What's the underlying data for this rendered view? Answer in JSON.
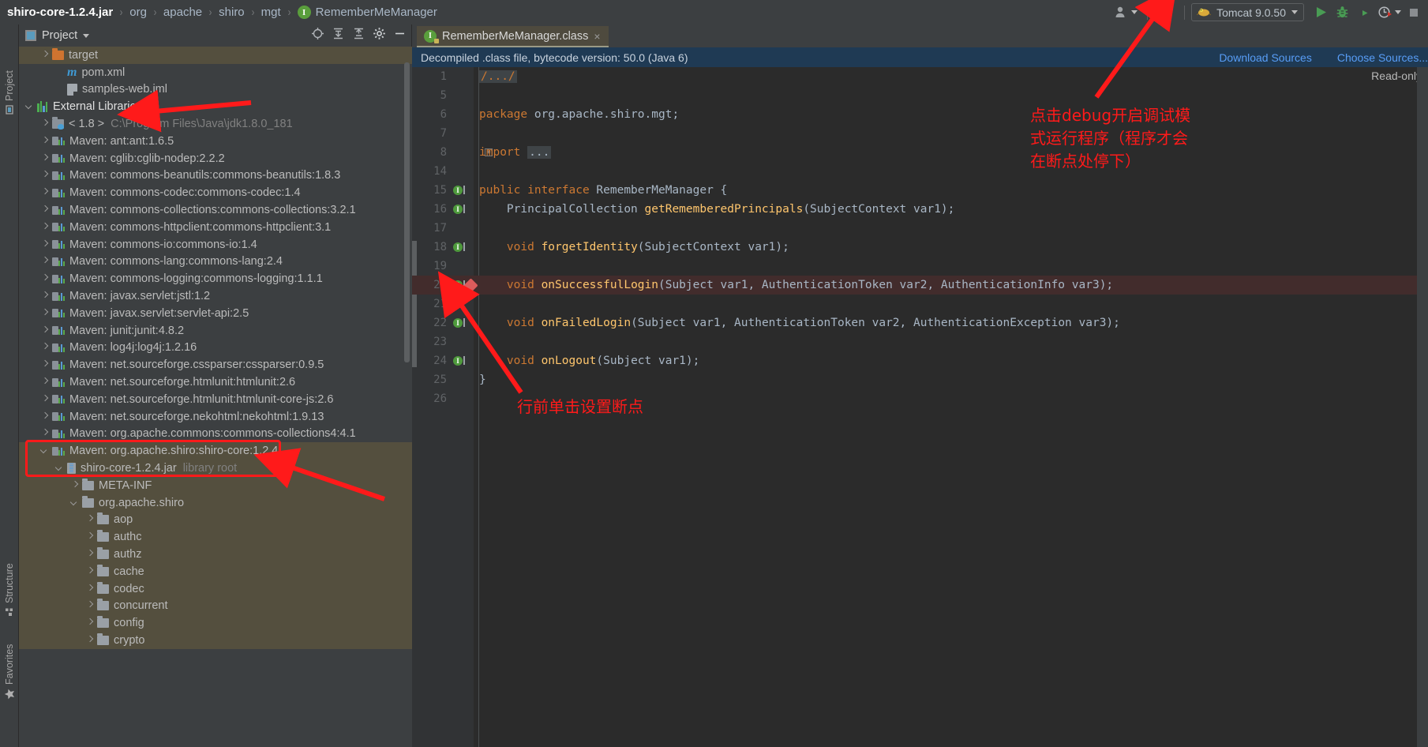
{
  "breadcrumb": {
    "items": [
      {
        "label": "shiro-core-1.2.4.jar",
        "strong": true
      },
      {
        "label": "org",
        "strong": false
      },
      {
        "label": "apache",
        "strong": false
      },
      {
        "label": "shiro",
        "strong": false
      },
      {
        "label": "mgt",
        "strong": false
      },
      {
        "label": "RememberMeManager",
        "strong": false,
        "badge": "I"
      }
    ],
    "separator": "›"
  },
  "toolbar": {
    "user_icon": "user-icon",
    "update_icon": "update-project-icon",
    "run_config": {
      "name": "Tomcat 9.0.50",
      "icon": "tomcat-icon"
    },
    "run_label": "Run",
    "debug_label": "Debug",
    "run_coverage_label": "Run with Coverage",
    "profiler_label": "Profiler",
    "stop_label": "Stop"
  },
  "left_strip": {
    "project_label": "Project",
    "structure_label": "Structure",
    "favorites_label": "Favorites"
  },
  "project_panel": {
    "title": "Project",
    "header_icons": [
      "locate-icon",
      "expand-all-icon",
      "collapse-all-icon",
      "settings-icon",
      "hide-icon"
    ],
    "tree": [
      {
        "indent": 1,
        "arrow": "right",
        "icon": "folder-orange",
        "label": "target",
        "selected": true
      },
      {
        "indent": 2,
        "arrow": "none",
        "icon": "maven-pom",
        "label": "pom.xml"
      },
      {
        "indent": 2,
        "arrow": "none",
        "icon": "iml-file",
        "label": "samples-web.iml"
      },
      {
        "indent": 0,
        "arrow": "down",
        "icon": "libraries",
        "label": "External Libraries",
        "white": true
      },
      {
        "indent": 1,
        "arrow": "right",
        "icon": "jdk",
        "label": "< 1.8 >",
        "sub": "C:\\Program Files\\Java\\jdk1.8.0_181"
      },
      {
        "indent": 1,
        "arrow": "right",
        "icon": "maven",
        "label": "Maven: ant:ant:1.6.5"
      },
      {
        "indent": 1,
        "arrow": "right",
        "icon": "maven",
        "label": "Maven: cglib:cglib-nodep:2.2.2"
      },
      {
        "indent": 1,
        "arrow": "right",
        "icon": "maven",
        "label": "Maven: commons-beanutils:commons-beanutils:1.8.3"
      },
      {
        "indent": 1,
        "arrow": "right",
        "icon": "maven",
        "label": "Maven: commons-codec:commons-codec:1.4"
      },
      {
        "indent": 1,
        "arrow": "right",
        "icon": "maven",
        "label": "Maven: commons-collections:commons-collections:3.2.1"
      },
      {
        "indent": 1,
        "arrow": "right",
        "icon": "maven",
        "label": "Maven: commons-httpclient:commons-httpclient:3.1"
      },
      {
        "indent": 1,
        "arrow": "right",
        "icon": "maven",
        "label": "Maven: commons-io:commons-io:1.4"
      },
      {
        "indent": 1,
        "arrow": "right",
        "icon": "maven",
        "label": "Maven: commons-lang:commons-lang:2.4"
      },
      {
        "indent": 1,
        "arrow": "right",
        "icon": "maven",
        "label": "Maven: commons-logging:commons-logging:1.1.1"
      },
      {
        "indent": 1,
        "arrow": "right",
        "icon": "maven",
        "label": "Maven: javax.servlet:jstl:1.2"
      },
      {
        "indent": 1,
        "arrow": "right",
        "icon": "maven",
        "label": "Maven: javax.servlet:servlet-api:2.5"
      },
      {
        "indent": 1,
        "arrow": "right",
        "icon": "maven",
        "label": "Maven: junit:junit:4.8.2"
      },
      {
        "indent": 1,
        "arrow": "right",
        "icon": "maven",
        "label": "Maven: log4j:log4j:1.2.16"
      },
      {
        "indent": 1,
        "arrow": "right",
        "icon": "maven",
        "label": "Maven: net.sourceforge.cssparser:cssparser:0.9.5"
      },
      {
        "indent": 1,
        "arrow": "right",
        "icon": "maven",
        "label": "Maven: net.sourceforge.htmlunit:htmlunit:2.6"
      },
      {
        "indent": 1,
        "arrow": "right",
        "icon": "maven",
        "label": "Maven: net.sourceforge.htmlunit:htmlunit-core-js:2.6"
      },
      {
        "indent": 1,
        "arrow": "right",
        "icon": "maven",
        "label": "Maven: net.sourceforge.nekohtml:nekohtml:1.9.13"
      },
      {
        "indent": 1,
        "arrow": "right",
        "icon": "maven",
        "label": "Maven: org.apache.commons:commons-collections4:4.1"
      },
      {
        "indent": 1,
        "arrow": "down",
        "icon": "maven",
        "label": "Maven: org.apache.shiro:shiro-core:1.2.4",
        "selected": true
      },
      {
        "indent": 2,
        "arrow": "down",
        "icon": "jar",
        "label": "shiro-core-1.2.4.jar",
        "sub": "library root",
        "selected": true
      },
      {
        "indent": 3,
        "arrow": "right",
        "icon": "folder",
        "label": "META-INF",
        "selected": true
      },
      {
        "indent": 3,
        "arrow": "down",
        "icon": "folder",
        "label": "org.apache.shiro",
        "selected": true
      },
      {
        "indent": 4,
        "arrow": "right",
        "icon": "folder",
        "label": "aop",
        "selected": true
      },
      {
        "indent": 4,
        "arrow": "right",
        "icon": "folder",
        "label": "authc",
        "selected": true
      },
      {
        "indent": 4,
        "arrow": "right",
        "icon": "folder",
        "label": "authz",
        "selected": true
      },
      {
        "indent": 4,
        "arrow": "right",
        "icon": "folder",
        "label": "cache",
        "selected": true
      },
      {
        "indent": 4,
        "arrow": "right",
        "icon": "folder",
        "label": "codec",
        "selected": true
      },
      {
        "indent": 4,
        "arrow": "right",
        "icon": "folder",
        "label": "concurrent",
        "selected": true
      },
      {
        "indent": 4,
        "arrow": "right",
        "icon": "folder",
        "label": "config",
        "selected": true
      },
      {
        "indent": 4,
        "arrow": "right",
        "icon": "folder",
        "label": "crypto",
        "selected": true
      }
    ]
  },
  "editor": {
    "tab": {
      "label": "RememberMeManager.class",
      "icon": "interface-locked-icon",
      "close": "×"
    },
    "banner": {
      "text": "Decompiled .class file, bytecode version: 50.0 (Java 6)",
      "links": [
        "Download Sources",
        "Choose Sources..."
      ]
    },
    "readonly_note": "Read-only",
    "lines": [
      {
        "num": "1",
        "fold": "+",
        "segments": [
          {
            "t": "/.../",
            "c": "fold-chip"
          }
        ]
      },
      {
        "num": "5",
        "segments": []
      },
      {
        "num": "6",
        "segments": [
          {
            "t": "package ",
            "c": "kw"
          },
          {
            "t": "org.apache.shiro.mgt;",
            "c": "pln"
          }
        ]
      },
      {
        "num": "7",
        "segments": []
      },
      {
        "num": "8",
        "fold": "+",
        "segments": [
          {
            "t": "import ",
            "c": "kw"
          },
          {
            "t": "...",
            "c": "fold-chip dots"
          }
        ]
      },
      {
        "num": "14",
        "segments": []
      },
      {
        "num": "15",
        "gmark": "I",
        "segments": [
          {
            "t": "public interface ",
            "c": "kw"
          },
          {
            "t": "RememberMeManager ",
            "c": "typ"
          },
          {
            "t": "{",
            "c": "pln"
          }
        ]
      },
      {
        "num": "16",
        "gmark": "I",
        "indent": 4,
        "segments": [
          {
            "t": "PrincipalCollection ",
            "c": "typ"
          },
          {
            "t": "getRememberedPrincipals",
            "c": "mth"
          },
          {
            "t": "(SubjectContext var1);",
            "c": "pln"
          }
        ]
      },
      {
        "num": "17",
        "segments": []
      },
      {
        "num": "18",
        "gmark": "I",
        "indent": 4,
        "segments": [
          {
            "t": "void ",
            "c": "kw"
          },
          {
            "t": "forgetIdentity",
            "c": "mth"
          },
          {
            "t": "(SubjectContext var1);",
            "c": "pln"
          }
        ]
      },
      {
        "num": "19",
        "segments": []
      },
      {
        "num": "20",
        "gmark": "I",
        "breakpoint": true,
        "highlight": true,
        "indent": 4,
        "segments": [
          {
            "t": "void ",
            "c": "kw"
          },
          {
            "t": "onSuccessfulLogin",
            "c": "mth"
          },
          {
            "t": "(Subject var1, AuthenticationToken var2, AuthenticationInfo var3);",
            "c": "pln"
          }
        ]
      },
      {
        "num": "21",
        "segments": []
      },
      {
        "num": "22",
        "gmark": "I",
        "indent": 4,
        "segments": [
          {
            "t": "void ",
            "c": "kw"
          },
          {
            "t": "onFailedLogin",
            "c": "mth"
          },
          {
            "t": "(Subject var1, AuthenticationToken var2, AuthenticationException var3);",
            "c": "pln"
          }
        ]
      },
      {
        "num": "23",
        "segments": []
      },
      {
        "num": "24",
        "gmark": "I",
        "indent": 4,
        "segments": [
          {
            "t": "void ",
            "c": "kw"
          },
          {
            "t": "onLogout",
            "c": "mth"
          },
          {
            "t": "(Subject var1);",
            "c": "pln"
          }
        ]
      },
      {
        "num": "25",
        "segments": [
          {
            "t": "}",
            "c": "pln"
          }
        ]
      },
      {
        "num": "26",
        "segments": []
      }
    ]
  },
  "annotations": {
    "debug_note": "点击debug开启调试模\n式运行程序（程序才会\n在断点处停下）",
    "breakpoint_note": "行前单击设置断点",
    "color": "#ff1a1a"
  }
}
